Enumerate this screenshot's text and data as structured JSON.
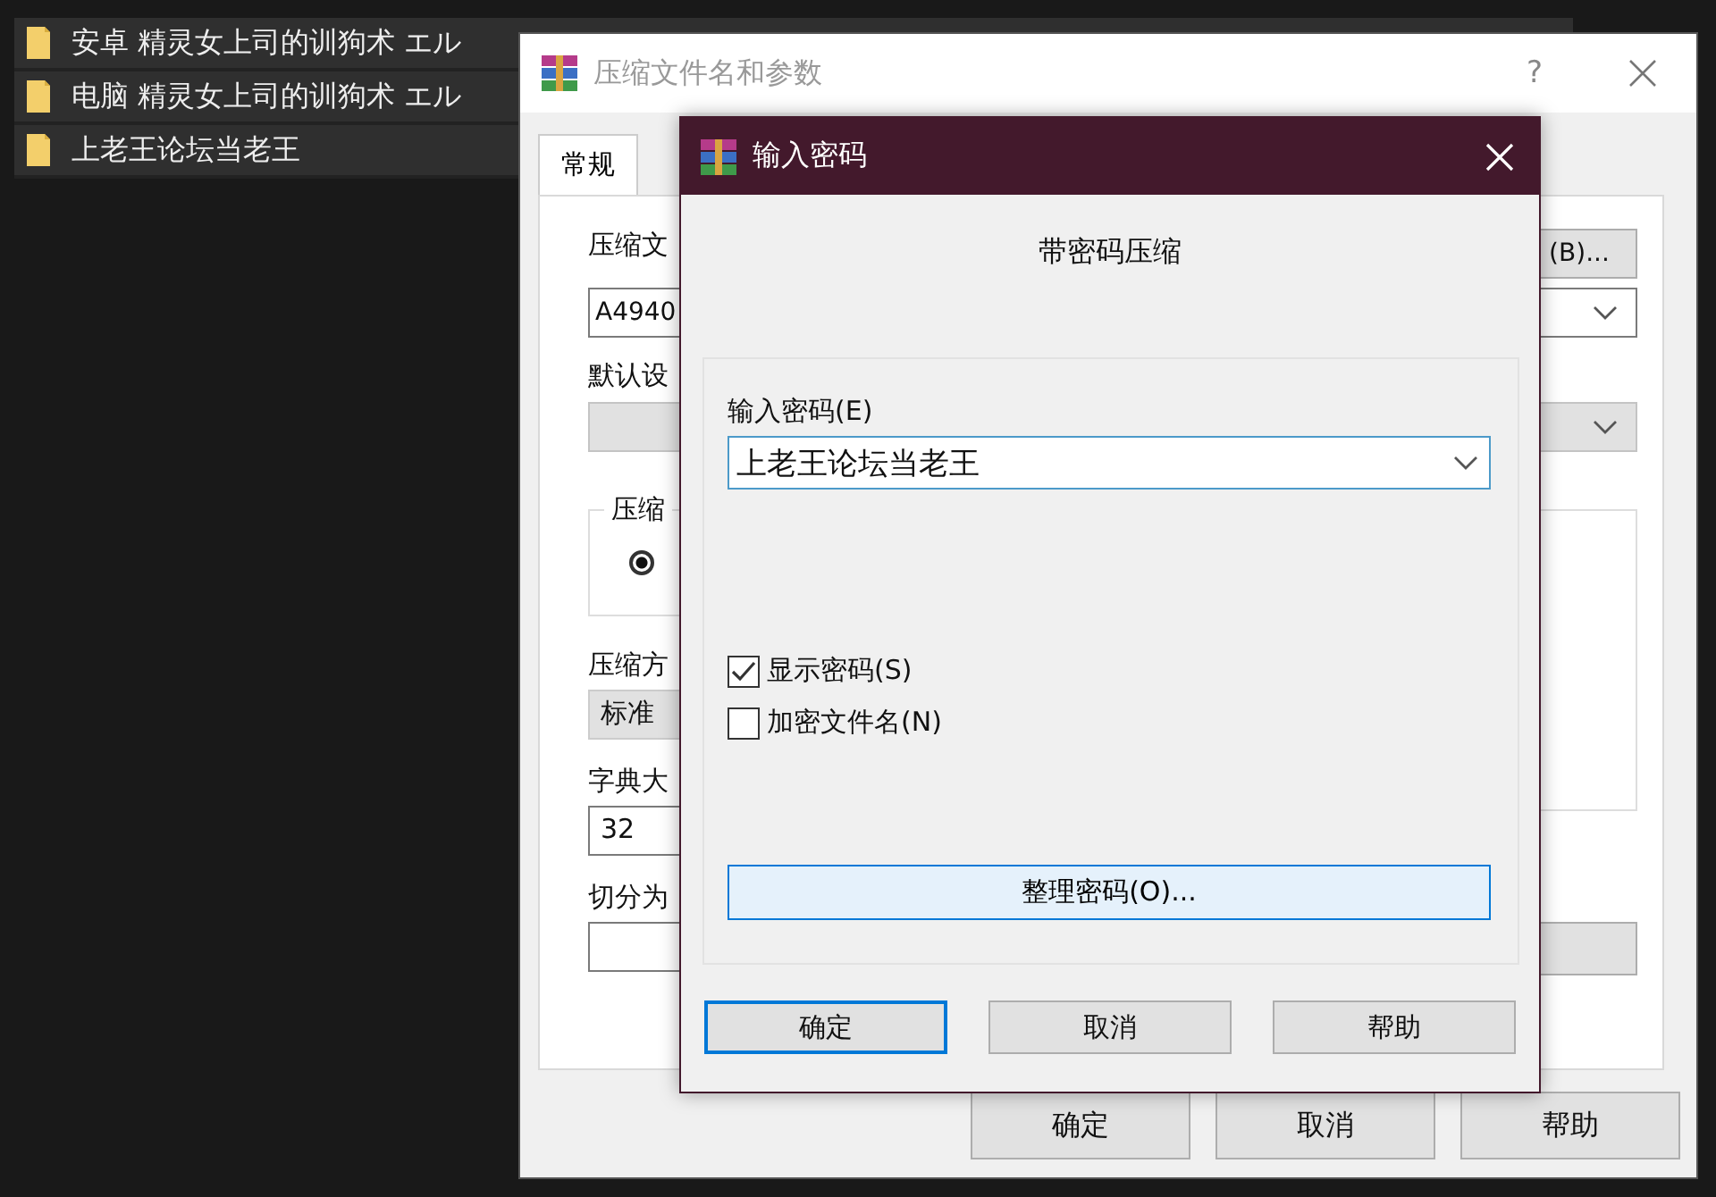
{
  "file_list": [
    {
      "name": "安卓 精灵女上司的训狗术 エル"
    },
    {
      "name": "电脑 精灵女上司的训狗术 エル"
    },
    {
      "name": "上老王论坛当老王"
    }
  ],
  "back_window": {
    "title": "压缩文件名和参数",
    "help_button": "?",
    "tabs": [
      {
        "label": "常规",
        "selected": true
      }
    ],
    "archive_name_label": "压缩文",
    "browse_button": "(B)...",
    "archive_name_value": "A4940",
    "profile_label": "默认设",
    "format_group_label": "压缩",
    "format_radio": {
      "selected": true
    },
    "method_label": "压缩方",
    "method_value": "标准",
    "dictionary_label": "字典大",
    "dictionary_value": "32",
    "split_label": "切分为",
    "buttons": [
      "确定",
      "取消",
      "帮助"
    ]
  },
  "password_dialog": {
    "title": "输入密码",
    "heading": "带密码压缩",
    "password_label": "输入密码(E)",
    "password_value": "上老王论坛当老王",
    "options": [
      {
        "label": "显示密码(S)",
        "checked": true
      },
      {
        "label": "加密文件名(N)",
        "checked": false
      }
    ],
    "organize_button": "整理密码(O)...",
    "buttons": [
      {
        "label": "确定",
        "focused": true
      },
      {
        "label": "取消",
        "focused": false
      },
      {
        "label": "帮助",
        "focused": false
      }
    ]
  }
}
